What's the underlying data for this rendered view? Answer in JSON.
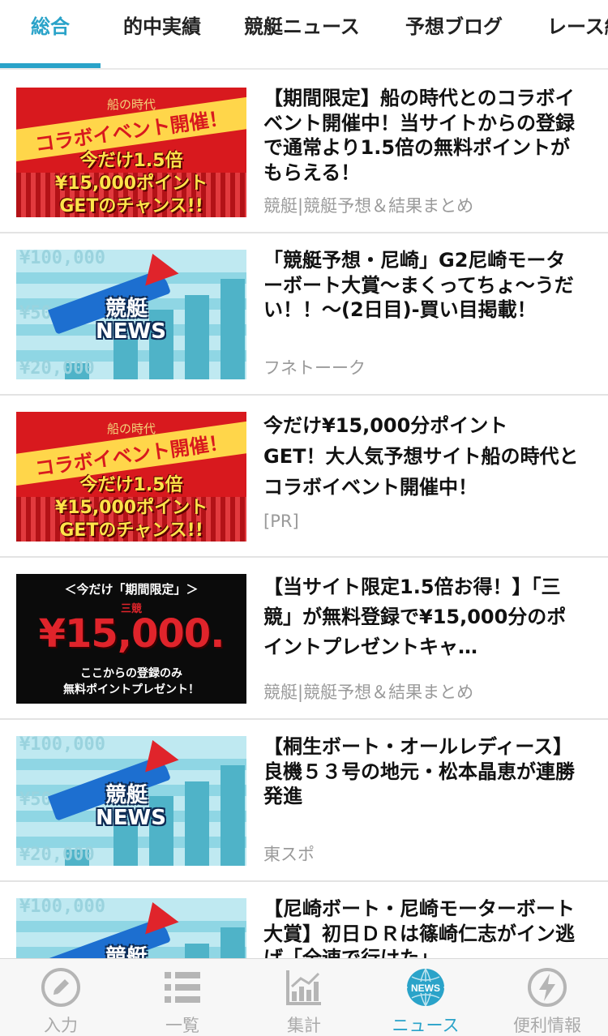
{
  "tabs": [
    {
      "label": "総合",
      "active": true
    },
    {
      "label": "的中実績",
      "active": false
    },
    {
      "label": "競艇ニュース",
      "active": false
    },
    {
      "label": "予想ブログ",
      "active": false
    },
    {
      "label": "レース結",
      "active": false
    }
  ],
  "thumbnails": {
    "collab": {
      "logo": "船の時代",
      "banner": "コラボイベント開催！",
      "line1": "今だけ1.5倍",
      "line2": "¥15,000ポイント",
      "line3": "GETのチャンス!!"
    },
    "news": {
      "yen_top": "¥100,000",
      "yen_mid": "¥50",
      "yen_bottom": "¥20,000",
      "word1": "競艇",
      "word2": "NEWS"
    },
    "sankei": {
      "top": "＜今だけ「期間限定」＞",
      "brand": "三競",
      "amount": "¥15,000.",
      "bottom1": "ここからの登録のみ",
      "bottom2": "無料ポイントプレゼント！"
    }
  },
  "articles": [
    {
      "title": "【期間限定】船の時代とのコラボイベント開催中！当サイトからの登録で通常より1.5倍の無料ポイントがもらえる！",
      "source": "競艇|競艇予想＆結果まとめ"
    },
    {
      "title": "「競艇予想・尼崎」G2尼崎モーターボート大賞〜まくってちょ〜うだい！！〜(2日目)-買い目掲載！",
      "source": "フネトーーク"
    },
    {
      "title": "今だけ¥15,000分ポイント\nGET！大人気予想サイト船の時代とコラボイベント開催中！",
      "source": "[PR]"
    },
    {
      "title": "【当サイト限定1.5倍お得！】「三競」が無料登録で¥15,000分のポイントプレゼントキャ…",
      "source": "競艇|競艇予想＆結果まとめ"
    },
    {
      "title": "【桐生ボート・オールレディース】良機５３号の地元・松本晶恵が連勝発進",
      "source": "東スポ"
    },
    {
      "title": "【尼崎ボート・尼崎モーターボート大賞】初日ＤＲは篠崎仁志がイン逃げ「全速で行けた」",
      "source": ""
    }
  ],
  "bottom_nav": [
    {
      "label": "入力",
      "icon": "pencil-icon",
      "active": false
    },
    {
      "label": "一覧",
      "icon": "list-icon",
      "active": false
    },
    {
      "label": "集計",
      "icon": "chart-icon",
      "active": false
    },
    {
      "label": "ニュース",
      "icon": "news-icon",
      "active": true
    },
    {
      "label": "便利情報",
      "icon": "bolt-icon",
      "active": false
    }
  ],
  "colors": {
    "accent": "#2aa3c9",
    "inactive": "#aaaaaa",
    "divider": "#e3e3e3"
  }
}
